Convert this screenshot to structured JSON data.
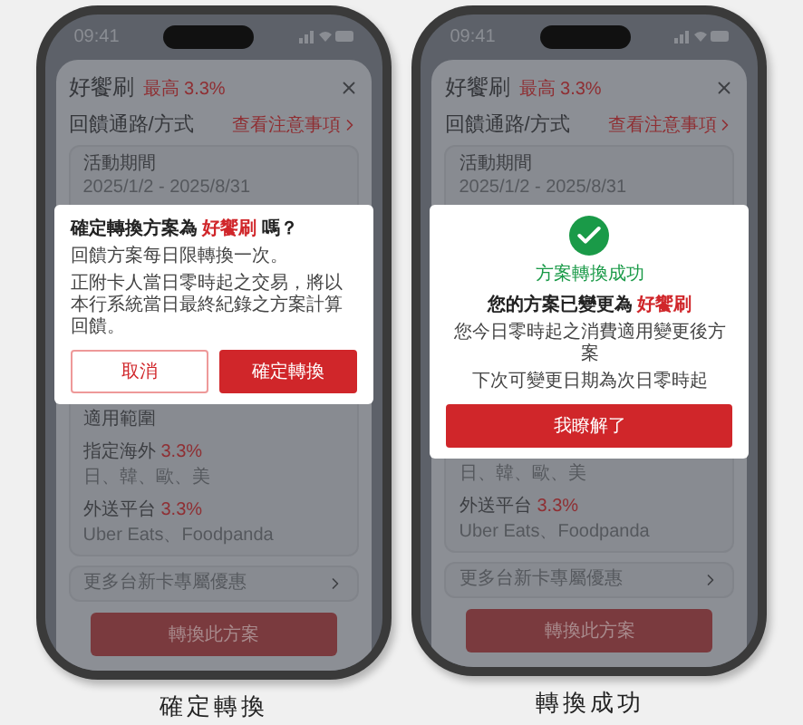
{
  "phones": [
    {
      "status_time": "09:41",
      "sheet": {
        "title": "好饗刷",
        "highlight": "最高 3.3%",
        "section": "回饋通路/方式",
        "link": "查看注意事項",
        "top_items": [
          {
            "kind": "label",
            "text": "活動期間"
          },
          {
            "kind": "note",
            "text": "2025/1/2 - 2025/8/31"
          }
        ],
        "bottom_items": [
          {
            "kind": "label",
            "text": "適用範圍"
          },
          {
            "kind": "rate",
            "text": "指定海外",
            "rate": "3.3%"
          },
          {
            "kind": "note",
            "text": "日、韓、歐、美"
          },
          {
            "kind": "rate",
            "text": "外送平台",
            "rate": "3.3%"
          },
          {
            "kind": "note",
            "text": "Uber Eats、Foodpanda"
          }
        ],
        "more": "更多台新卡專屬優惠",
        "cta": "轉換此方案"
      },
      "dialog": {
        "kind": "confirm",
        "title_before": "確定轉換方案為",
        "title_em": "好饗刷",
        "title_after": "嗎？",
        "body": [
          "回饋方案每日限轉換一次。",
          "正附卡人當日零時起之交易，將以本行系統當日最終紀錄之方案計算回饋。"
        ],
        "buttons": [
          {
            "kind": "outline",
            "label": "取消"
          },
          {
            "kind": "primary",
            "label": "確定轉換"
          }
        ]
      },
      "caption": "確定轉換"
    },
    {
      "status_time": "09:41",
      "sheet": {
        "title": "好饗刷",
        "highlight": "最高 3.3%",
        "section": "回饋通路/方式",
        "link": "查看注意事項",
        "top_items": [
          {
            "kind": "label",
            "text": "活動期間"
          },
          {
            "kind": "note",
            "text": "2025/1/2 - 2025/8/31"
          }
        ],
        "bottom_items": [
          {
            "kind": "note",
            "text": "日、韓、歐、美"
          },
          {
            "kind": "rate",
            "text": "外送平台",
            "rate": "3.3%"
          },
          {
            "kind": "note",
            "text": "Uber Eats、Foodpanda"
          }
        ],
        "more": "更多台新卡專屬優惠",
        "cta": "轉換此方案"
      },
      "dialog": {
        "kind": "success",
        "status": "方案轉換成功",
        "title_before": "您的方案已變更為",
        "title_em": "好饗刷",
        "body": [
          "您今日零時起之消費適用變更後方案",
          "下次可變更日期為次日零時起"
        ],
        "buttons": [
          {
            "kind": "primary",
            "label": "我瞭解了"
          }
        ]
      },
      "caption": "轉換成功"
    }
  ]
}
